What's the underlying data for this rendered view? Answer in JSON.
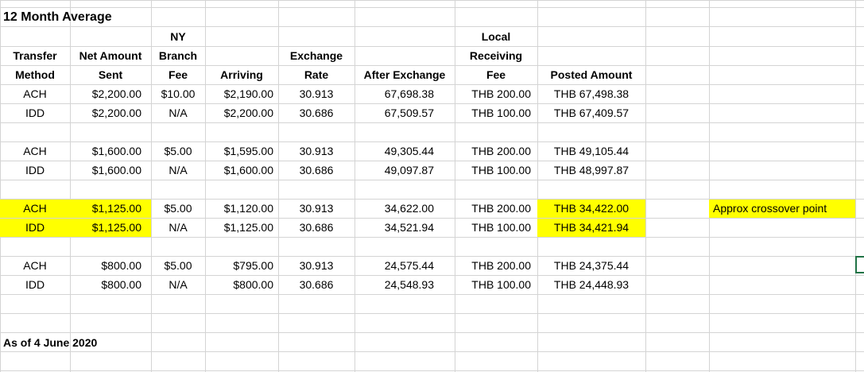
{
  "title": "12 Month Average",
  "footer": "As of 4 June 2020",
  "headers": [
    [
      "",
      "",
      "NY",
      "",
      "",
      "",
      "Local",
      ""
    ],
    [
      "Transfer",
      "Net Amount",
      "Branch",
      "",
      "Exchange",
      "",
      "Receiving",
      ""
    ],
    [
      "Method",
      "Sent",
      "Fee",
      "Arriving",
      "Rate",
      "After Exchange",
      "Fee",
      "Posted Amount"
    ]
  ],
  "groups": [
    {
      "rows": [
        [
          "ACH",
          "$2,200.00",
          "$10.00",
          "$2,190.00",
          "30.913",
          "67,698.38",
          "THB 200.00",
          "THB 67,498.38"
        ],
        [
          "IDD",
          "$2,200.00",
          "N/A",
          "$2,200.00",
          "30.686",
          "67,509.57",
          "THB 100.00",
          "THB 67,409.57"
        ]
      ]
    },
    {
      "rows": [
        [
          "ACH",
          "$1,600.00",
          "$5.00",
          "$1,595.00",
          "30.913",
          "49,305.44",
          "THB 200.00",
          "THB 49,105.44"
        ],
        [
          "IDD",
          "$1,600.00",
          "N/A",
          "$1,600.00",
          "30.686",
          "49,097.87",
          "THB 100.00",
          "THB 48,997.87"
        ]
      ]
    },
    {
      "rows": [
        [
          "ACH",
          "$1,125.00",
          "$5.00",
          "$1,120.00",
          "30.913",
          "34,622.00",
          "THB 200.00",
          "THB 34,422.00"
        ],
        [
          "IDD",
          "$1,125.00",
          "N/A",
          "$1,125.00",
          "30.686",
          "34,521.94",
          "THB 100.00",
          "THB 34,421.94"
        ]
      ],
      "note": "Approx crossover point"
    },
    {
      "rows": [
        [
          "ACH",
          "$800.00",
          "$5.00",
          "$795.00",
          "30.913",
          "24,575.44",
          "THB 200.00",
          "THB 24,375.44"
        ],
        [
          "IDD",
          "$800.00",
          "N/A",
          "$800.00",
          "30.686",
          "24,548.93",
          "THB 100.00",
          "THB 24,448.93"
        ]
      ]
    }
  ],
  "colors": {
    "highlight": "#ffff00",
    "gridline": "#d4d4d4",
    "selection": "#217346"
  }
}
